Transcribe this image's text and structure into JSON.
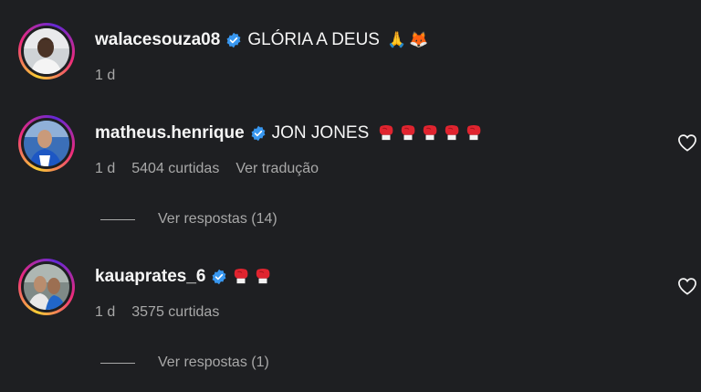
{
  "comments": [
    {
      "username": "walacesouza08",
      "verified": true,
      "text": "GLÓRIA A DEUS",
      "emojis": [
        "🙏",
        "🦊"
      ],
      "time": "1 d",
      "likes": "",
      "translate": ""
    },
    {
      "username": "matheus.henrique",
      "verified": true,
      "text": "JON JONES",
      "emoji_count": 5,
      "time": "1 d",
      "likes": "5404 curtidas",
      "translate": "Ver tradução",
      "replies": "Ver respostas (14)"
    },
    {
      "username": "kauaprates_6",
      "verified": true,
      "text": "",
      "emoji_count": 2,
      "time": "1 d",
      "likes": "3575 curtidas",
      "replies": "Ver respostas (1)"
    }
  ],
  "colors": {
    "background": "#1e1f22",
    "text_primary": "#f5f5f5",
    "text_secondary": "#a8a8a8",
    "verified": "#3897f0",
    "glove": "#e0242f"
  },
  "icons": [
    "verified-badge-icon",
    "heart-icon",
    "boxing-glove-icon"
  ]
}
